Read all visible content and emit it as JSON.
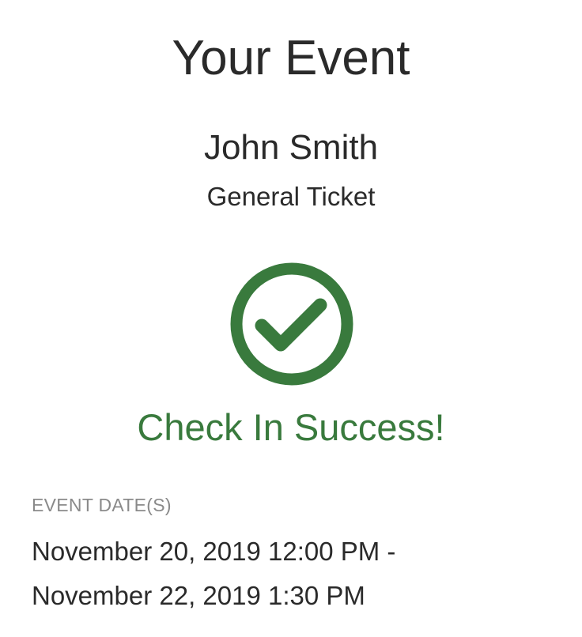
{
  "event": {
    "title": "Your Event"
  },
  "attendee": {
    "name": "John Smith",
    "ticket_type": "General Ticket"
  },
  "status": {
    "icon": "check-circle-icon",
    "message": "Check In Success!",
    "color": "#397a3d"
  },
  "event_dates": {
    "label": "EVENT DATE(S)",
    "start": "November 20, 2019 12:00 PM -",
    "end": "November 22, 2019 1:30 PM"
  }
}
